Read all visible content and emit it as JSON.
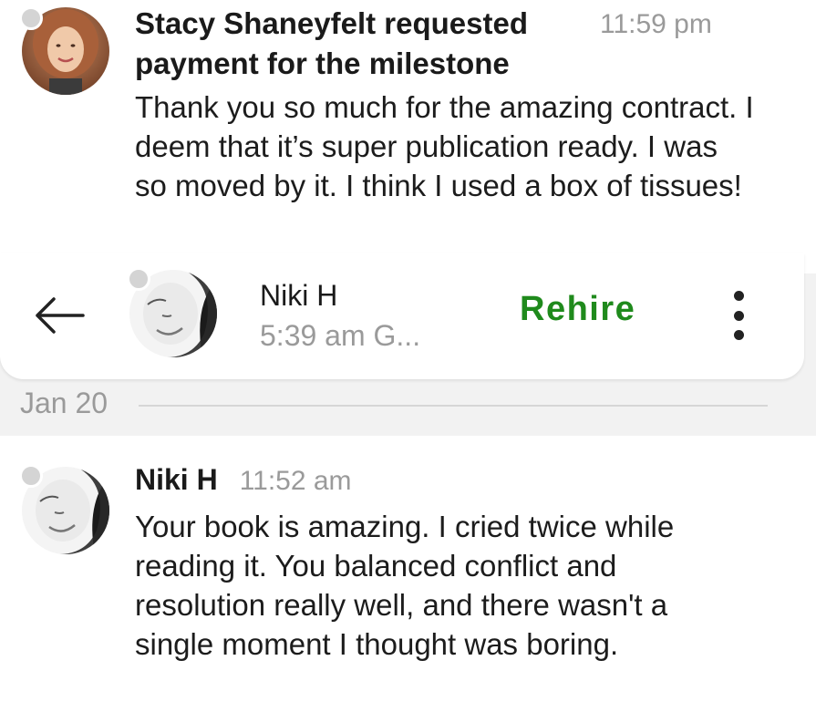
{
  "top_message": {
    "sender": "Stacy Shaneyfelt",
    "title": "Stacy Shaneyfelt requested payment for the milestone",
    "time": "11:59 pm",
    "body": "Thank you so much for the amazing contract. I deem that it’s super publication ready. I was so moved by it. I think I used a box of tissues!"
  },
  "header": {
    "back_icon": "arrow-left-icon",
    "contact_name": "Niki H",
    "contact_status": "5:39 am G...",
    "rehire_label": "Rehire",
    "more_icon": "more-vertical-icon",
    "accent_color": "#1f8a1c"
  },
  "date_divider": {
    "label": "Jan 20"
  },
  "bottom_message": {
    "sender": "Niki H",
    "time": "11:52 am",
    "body": "Your book is amazing. I cried twice while reading it. You balanced conflict and resolution really well, and there wasn't a single moment I thought was boring."
  }
}
